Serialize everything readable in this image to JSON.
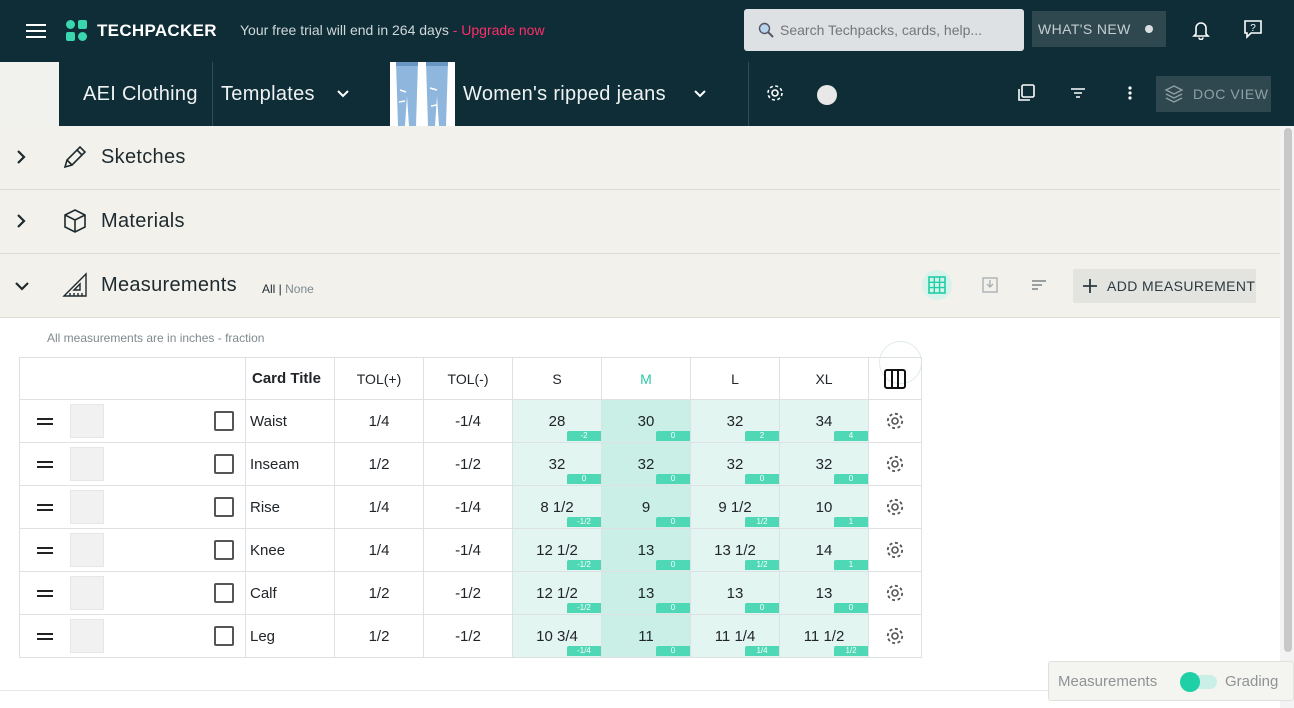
{
  "topbar": {
    "brand": "TECHPACKER",
    "trial_text": "Your free trial will end in 264 days",
    "trial_sep": " - ",
    "upgrade_label": "Upgrade now",
    "search_placeholder": "Search Techpacks, cards, help...",
    "whats_new_label": "WHAT'S NEW"
  },
  "subbar": {
    "company": "AEI Clothing",
    "folder": "Templates",
    "techpack": "Women's ripped jeans",
    "doc_view_label": "DOC VIEW"
  },
  "sections": [
    {
      "title": "Sketches",
      "icon": "pencil-icon",
      "expanded": false
    },
    {
      "title": "Materials",
      "icon": "cube-icon",
      "expanded": false
    },
    {
      "title": "Measurements",
      "icon": "ruler-triangle-icon",
      "expanded": true
    }
  ],
  "measurements": {
    "filter_all": "All",
    "filter_sep": " | ",
    "filter_none": "None",
    "add_label": "ADD MEASUREMENT",
    "units_note": "All measurements are in inches - fraction",
    "headers": {
      "card_title": "Card Title",
      "tol_plus": "TOL(+)",
      "tol_minus": "TOL(-)",
      "sizes": [
        "S",
        "M",
        "L",
        "XL"
      ],
      "base_size": "M"
    },
    "rows": [
      {
        "title": "Waist",
        "tol_plus": "1/4",
        "tol_minus": "-1/4",
        "values": [
          "28",
          "30",
          "32",
          "34"
        ],
        "grades": [
          "-2",
          "0",
          "2",
          "4"
        ]
      },
      {
        "title": "Inseam",
        "tol_plus": "1/2",
        "tol_minus": "-1/2",
        "values": [
          "32",
          "32",
          "32",
          "32"
        ],
        "grades": [
          "0",
          "0",
          "0",
          "0"
        ]
      },
      {
        "title": "Rise",
        "tol_plus": "1/4",
        "tol_minus": "-1/4",
        "values": [
          "8 1/2",
          "9",
          "9 1/2",
          "10"
        ],
        "grades": [
          "-1/2",
          "0",
          "1/2",
          "1"
        ]
      },
      {
        "title": "Knee",
        "tol_plus": "1/4",
        "tol_minus": "-1/4",
        "values": [
          "12 1/2",
          "13",
          "13 1/2",
          "14"
        ],
        "grades": [
          "-1/2",
          "0",
          "1/2",
          "1"
        ]
      },
      {
        "title": "Calf",
        "tol_plus": "1/2",
        "tol_minus": "-1/2",
        "values": [
          "12 1/2",
          "13",
          "13",
          "13"
        ],
        "grades": [
          "-1/2",
          "0",
          "0",
          "0"
        ]
      },
      {
        "title": "Leg",
        "tol_plus": "1/2",
        "tol_minus": "-1/2",
        "values": [
          "10 3/4",
          "11",
          "11 1/4",
          "11 1/2"
        ],
        "grades": [
          "-1/4",
          "0",
          "1/4",
          "1/2"
        ]
      }
    ]
  },
  "mode_toggle": {
    "left_label": "Measurements",
    "right_label": "Grading"
  },
  "colors": {
    "topbar_bg": "#0f2d36",
    "accent": "#1fcfa5",
    "upgrade": "#ff2d6a",
    "section_bg": "#f3f1ec"
  }
}
